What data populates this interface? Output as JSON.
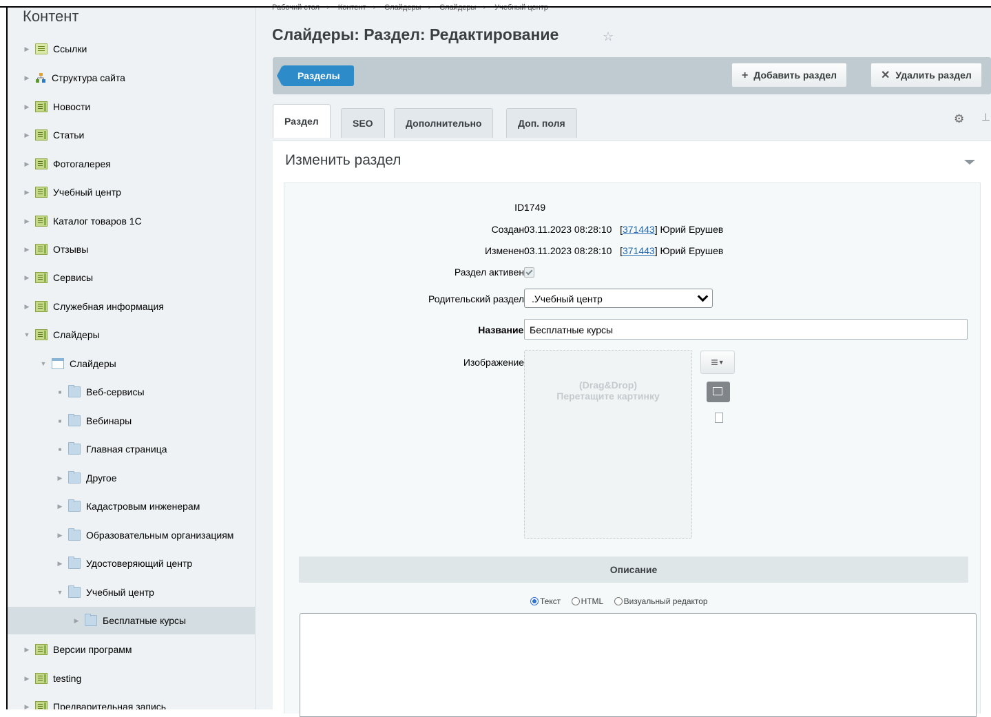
{
  "sidebar": {
    "title": "Контент",
    "items": [
      {
        "label": "Ссылки",
        "icon": "list-icon"
      },
      {
        "label": "Структура сайта",
        "icon": "structure-icon"
      },
      {
        "label": "Новости",
        "icon": "book-icon"
      },
      {
        "label": "Статьи",
        "icon": "book-icon"
      },
      {
        "label": "Фотогалерея",
        "icon": "book-icon"
      },
      {
        "label": "Учебный центр",
        "icon": "book-icon"
      },
      {
        "label": "Каталог товаров 1С",
        "icon": "book-icon"
      },
      {
        "label": "Отзывы",
        "icon": "book-icon"
      },
      {
        "label": "Сервисы",
        "icon": "book-icon"
      },
      {
        "label": "Служебная информация",
        "icon": "book-icon"
      },
      {
        "label": "Слайдеры",
        "icon": "book-icon"
      },
      {
        "label": "Слайдеры",
        "icon": "calendar-icon"
      },
      {
        "label": "Веб-сервисы",
        "icon": "folder-icon"
      },
      {
        "label": "Вебинары",
        "icon": "folder-icon"
      },
      {
        "label": "Главная страница",
        "icon": "folder-icon"
      },
      {
        "label": "Другое",
        "icon": "folder-icon"
      },
      {
        "label": "Кадастровым инженерам",
        "icon": "folder-icon"
      },
      {
        "label": "Образовательным организациям",
        "icon": "folder-icon"
      },
      {
        "label": "Удостоверяющий центр",
        "icon": "folder-icon"
      },
      {
        "label": "Учебный центр",
        "icon": "folder-icon"
      },
      {
        "label": "Бесплатные курсы",
        "icon": "folder-icon"
      },
      {
        "label": "Версии программ",
        "icon": "book-icon"
      },
      {
        "label": "testing",
        "icon": "book-icon"
      },
      {
        "label": "Предварительная запись",
        "icon": "book-icon"
      }
    ]
  },
  "breadcrumb": [
    "Рабочий стол",
    "Контент",
    "Слайдеры",
    "Слайдеры",
    "Учебный центр"
  ],
  "page": {
    "title": "Слайдеры: Раздел: Редактирование",
    "star_icon": "star-icon"
  },
  "toolbar": {
    "sections_label": "Разделы",
    "add_label": "Добавить раздел",
    "delete_label": "Удалить раздел"
  },
  "tabs": [
    "Раздел",
    "SEO",
    "Дополнительно",
    "Доп. поля"
  ],
  "panel": {
    "title": "Изменить раздел"
  },
  "form": {
    "id_label": "ID:",
    "id_value": "1749",
    "created_label": "Создан:",
    "created_date": "03.11.2023 08:28:10",
    "created_user_id": "371443",
    "created_user_name": "Юрий Ерушев",
    "modified_label": "Изменен:",
    "modified_date": "03.11.2023 08:28:10",
    "modified_user_id": "371443",
    "modified_user_name": "Юрий Ерушев",
    "active_label": "Раздел активен:",
    "active": true,
    "parent_label": "Родительский раздел:",
    "parent_value": ".Учебный центр",
    "name_label": "Название:",
    "name_value": "Бесплатные курсы",
    "image_label": "Изображение:",
    "dropzone_line1": "(Drag&Drop)",
    "dropzone_line2": "Перетащите картинку",
    "description_label": "Описание",
    "radio_text": "Текст",
    "radio_html": "HTML",
    "radio_visual": "Визуальный редактор",
    "radio_selected": "Текст"
  },
  "colors": {
    "accent": "#2e8bc9",
    "sidebar_bg": "#eef2f4",
    "selected_bg": "#d4dde1"
  }
}
